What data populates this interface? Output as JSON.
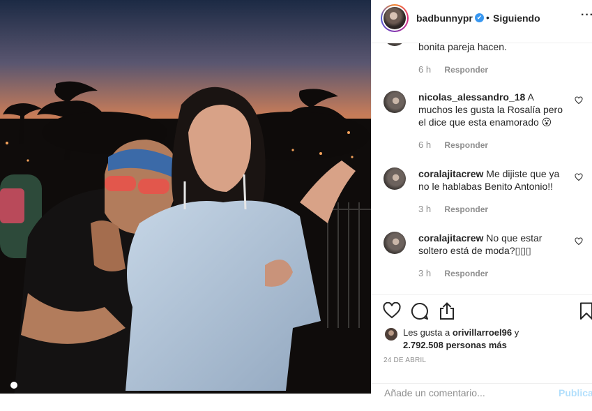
{
  "header": {
    "username": "badbunnypr",
    "verified": "✔",
    "separator": "•",
    "follow_status": "Siguiendo",
    "more": "···"
  },
  "comments": [
    {
      "text": "bonita pareja hacen.",
      "time": "6 h",
      "reply": "Responder"
    },
    {
      "user": "nicolas_alessandro_18",
      "text": "A muchos les gusta la Rosalía pero el dice que esta enamorado 😮",
      "time": "6 h",
      "reply": "Responder"
    },
    {
      "user": "coralajitacrew",
      "text": "Me dijiste que ya no le hablabas Benito Antonio!!",
      "time": "3 h",
      "reply": "Responder"
    },
    {
      "user": "coralajitacrew",
      "text": "No que estar soltero está de moda?▯▯▯",
      "time": "3 h",
      "reply": "Responder"
    }
  ],
  "likes": {
    "prefix": "Les gusta a",
    "user": "orivillarroel96",
    "conj": "y",
    "count": "2.792.508 personas más"
  },
  "date": "24 DE ABRIL",
  "add_comment": {
    "placeholder": "Añade un comentario...",
    "publish": "Publicar"
  },
  "icons": {
    "like": "heart-icon",
    "comment": "comment-icon",
    "share": "share-icon",
    "save": "bookmark-icon"
  }
}
